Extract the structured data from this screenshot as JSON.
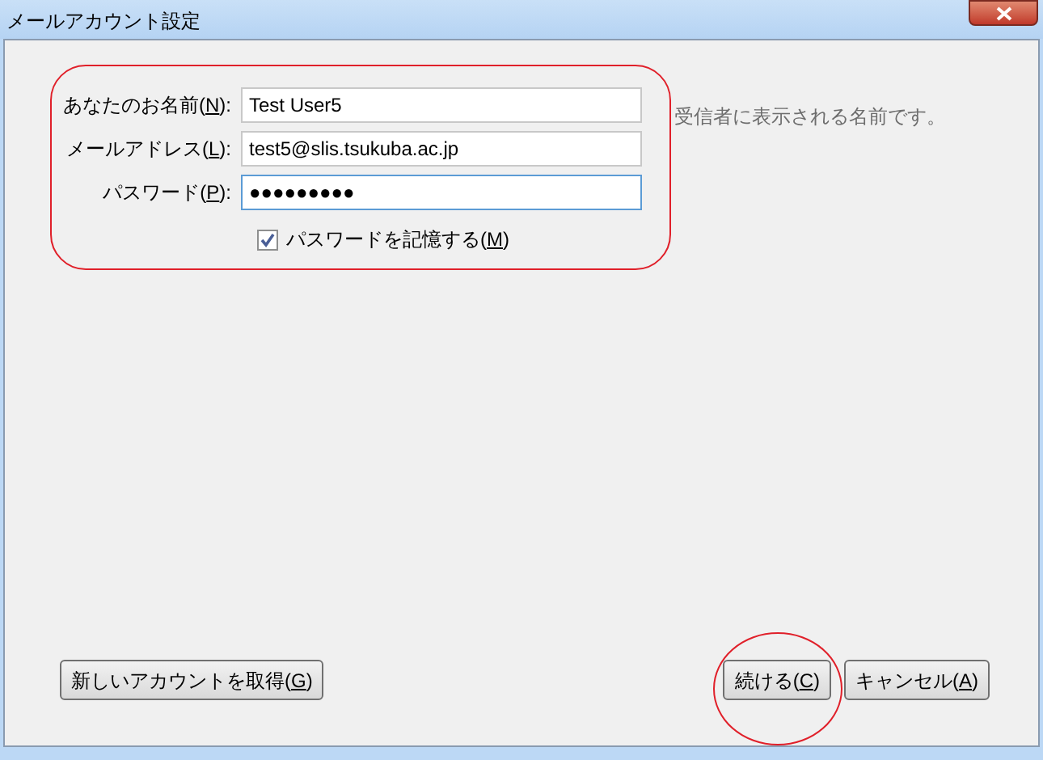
{
  "window": {
    "title": "メールアカウント設定"
  },
  "form": {
    "highlighted": true,
    "fields": [
      {
        "label": "あなたのお名前(",
        "key": "N",
        "after": "):",
        "value": "Test User5",
        "focused": false,
        "hint": "受信者に表示される名前です。"
      },
      {
        "label": "メールアドレス(",
        "key": "L",
        "after": "):",
        "value": "test5@slis.tsukuba.ac.jp",
        "focused": false
      },
      {
        "label": "パスワード(",
        "key": "P",
        "after": "):",
        "value": "●●●●●●●●●",
        "focused": true
      }
    ],
    "remember": {
      "label": "パスワードを記憶する(",
      "key": "M",
      "after": ")",
      "checked": true
    }
  },
  "buttons": [
    {
      "label": "新しいアカウントを取得(",
      "key": "G",
      "after": ")",
      "highlighted": false
    },
    {
      "label": "続ける(",
      "key": "C",
      "after": ")",
      "highlighted": true
    },
    {
      "label": "キャンセル(",
      "key": "A",
      "after": ")",
      "highlighted": false
    }
  ]
}
